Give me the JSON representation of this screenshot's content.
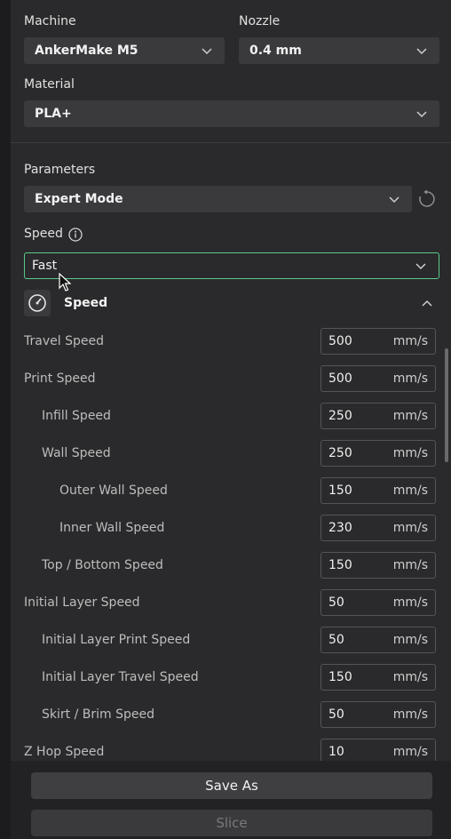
{
  "machine": {
    "label": "Machine",
    "value": "AnkerMake M5"
  },
  "nozzle": {
    "label": "Nozzle",
    "value": "0.4 mm"
  },
  "material": {
    "label": "Material",
    "value": "PLA+"
  },
  "parameters": {
    "label": "Parameters",
    "value": "Expert Mode"
  },
  "speed_preset": {
    "label": "Speed",
    "value": "Fast"
  },
  "section": {
    "title": "Speed"
  },
  "rows": [
    {
      "label": "Travel Speed",
      "value": "500",
      "unit": "mm/s"
    },
    {
      "label": "Print Speed",
      "value": "500",
      "unit": "mm/s"
    },
    {
      "label": "Infill Speed",
      "value": "250",
      "unit": "mm/s"
    },
    {
      "label": "Wall Speed",
      "value": "250",
      "unit": "mm/s"
    },
    {
      "label": "Outer Wall Speed",
      "value": "150",
      "unit": "mm/s"
    },
    {
      "label": "Inner Wall Speed",
      "value": "230",
      "unit": "mm/s"
    },
    {
      "label": "Top / Bottom Speed",
      "value": "150",
      "unit": "mm/s"
    },
    {
      "label": "Initial Layer Speed",
      "value": "50",
      "unit": "mm/s"
    },
    {
      "label": "Initial Layer Print Speed",
      "value": "50",
      "unit": "mm/s"
    },
    {
      "label": "Initial Layer Travel Speed",
      "value": "150",
      "unit": "mm/s"
    },
    {
      "label": "Skirt / Brim Speed",
      "value": "50",
      "unit": "mm/s"
    },
    {
      "label": "Z Hop Speed",
      "value": "10",
      "unit": "mm/s"
    }
  ],
  "footer": {
    "save_as": "Save As",
    "slice": "Slice"
  },
  "colors": {
    "accent_outline": "#5cc98a",
    "panel_bg": "#2a2a2c"
  },
  "icons": [
    "chevron-down-icon",
    "reset-icon",
    "info-icon",
    "speedometer-icon",
    "chevron-up-icon"
  ]
}
